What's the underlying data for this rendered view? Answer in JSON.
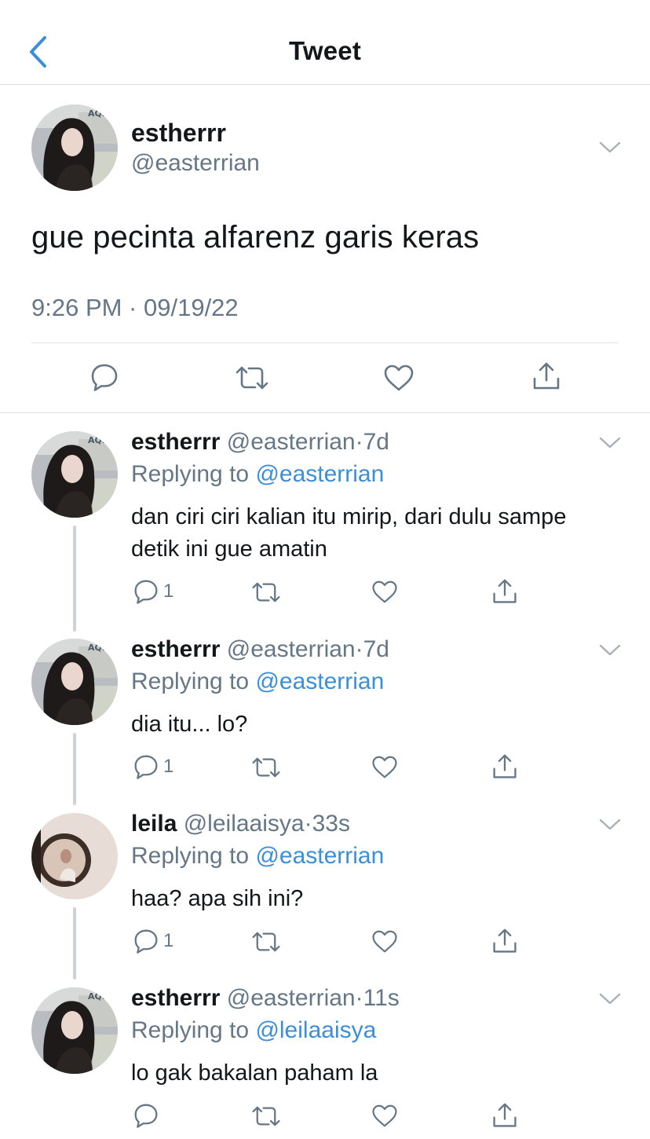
{
  "header": {
    "title": "Tweet",
    "back_icon": "chevron-left-icon"
  },
  "colors": {
    "accent": "#3b8fd9",
    "muted": "#657786",
    "text": "#14171a"
  },
  "main_tweet": {
    "name": "estherrr",
    "handle": "@easterrian",
    "text": "gue pecinta alfarenz garis keras",
    "timestamp": "9:26 PM · 09/19/22",
    "actions": [
      "reply-icon",
      "retweet-icon",
      "like-icon",
      "share-icon"
    ]
  },
  "replies": [
    {
      "name": "estherrr",
      "handle": "@easterrian",
      "dot": "·",
      "time": "7d",
      "replying_label": "Replying to",
      "replying_to": "@easterrian",
      "text": "dan ciri ciri kalian itu mirip, dari dulu sampe detik ini gue amatin",
      "reply_count": "1"
    },
    {
      "name": "estherrr",
      "handle": "@easterrian",
      "dot": "·",
      "time": "7d",
      "replying_label": "Replying to",
      "replying_to": "@easterrian",
      "text": "dia itu... lo?",
      "reply_count": "1"
    },
    {
      "name": "leila",
      "handle": "@leilaaisya",
      "dot": "·",
      "time": "33s",
      "replying_label": "Replying to",
      "replying_to": "@easterrian",
      "text": "haa? apa sih ini?",
      "reply_count": "1"
    },
    {
      "name": "estherrr",
      "handle": "@easterrian",
      "dot": "·",
      "time": "11s",
      "replying_label": "Replying to",
      "replying_to": "@leilaaisya",
      "text": "lo gak bakalan paham la",
      "reply_count": ""
    }
  ]
}
